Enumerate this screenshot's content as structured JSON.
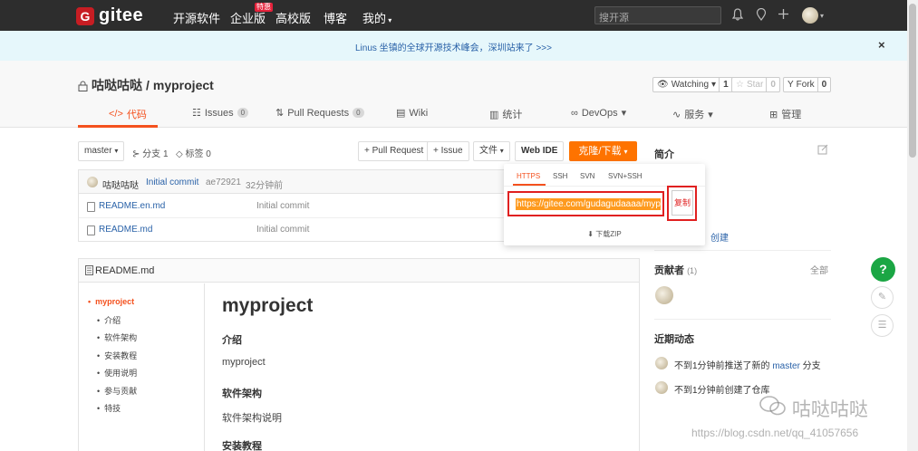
{
  "nav": {
    "logo_letter": "G",
    "logo_text": "gitee",
    "links": [
      "开源软件",
      "企业版",
      "高校版",
      "博客",
      "我的"
    ],
    "hot_badge": "特惠",
    "search_placeholder": "搜开源"
  },
  "announce": {
    "text": "Linus 坐镇的全球开源技术峰会，深圳站来了 >>>",
    "close": "×"
  },
  "repo": {
    "owner": "咕哒咕哒",
    "separator": "/",
    "name": "myproject",
    "watch_label": "Watching",
    "watch_count": "1",
    "star_label": "Star",
    "star_count": "0",
    "fork_label": "Fork",
    "fork_count": "0"
  },
  "tabs": [
    {
      "label": "代码",
      "icon": "code-icon"
    },
    {
      "label": "Issues",
      "badge": "0"
    },
    {
      "label": "Pull Requests",
      "badge": "0"
    },
    {
      "label": "Wiki"
    },
    {
      "label": "统计"
    },
    {
      "label": "DevOps"
    },
    {
      "label": "服务"
    },
    {
      "label": "管理"
    }
  ],
  "toolbar": {
    "branch": "master",
    "branches": "分支 1",
    "tags": "标签 0",
    "pull_request": "+ Pull Request",
    "issue": "+ Issue",
    "file": "文件",
    "webide": "Web IDE",
    "clone": "克隆/下载"
  },
  "commit": {
    "author": "咕哒咕哒",
    "message": "Initial commit",
    "hash": "ae72921",
    "time": "32分钟前"
  },
  "files": [
    {
      "name": "README.en.md",
      "message": "Initial commit"
    },
    {
      "name": "README.md",
      "message": "Initial commit"
    }
  ],
  "clone_dropdown": {
    "tabs": [
      "HTTPS",
      "SSH",
      "SVN",
      "SVN+SSH"
    ],
    "url": "https://gitee.com/gudagudaaaa/myproject.git",
    "copy": "复制",
    "download_zip": "下载ZIP"
  },
  "readme": {
    "title": "README.md",
    "toc": [
      "myproject",
      "介绍",
      "软件架构",
      "安装教程",
      "使用说明",
      "参与贡献",
      "特技"
    ],
    "h1": "myproject",
    "sections": [
      {
        "heading": "介绍",
        "text": "myproject"
      },
      {
        "heading": "软件架构",
        "text": "软件架构说明"
      },
      {
        "heading": "安装教程"
      }
    ]
  },
  "sidebar": {
    "intro_title": "简介",
    "create_link": "创建",
    "contributors_title": "贡献者",
    "contributors_count": "(1)",
    "all": "全部",
    "activity_title": "近期动态",
    "activities": [
      {
        "pre": "不到1分钟前推送了新的 ",
        "link": "master",
        "post": " 分支"
      },
      {
        "pre": "不到1分钟前创建了仓库",
        "link": "",
        "post": ""
      }
    ]
  },
  "float": {
    "help": "?"
  },
  "watermark": {
    "account": "咕哒咕哒",
    "url": "https://blog.csdn.net/qq_41057656"
  },
  "colors": {
    "nav_bg": "#2d2d2d",
    "accent": "#fe7300",
    "link": "#2a62a8",
    "highlight_border": "#e02020",
    "help_green": "#1ba644"
  }
}
